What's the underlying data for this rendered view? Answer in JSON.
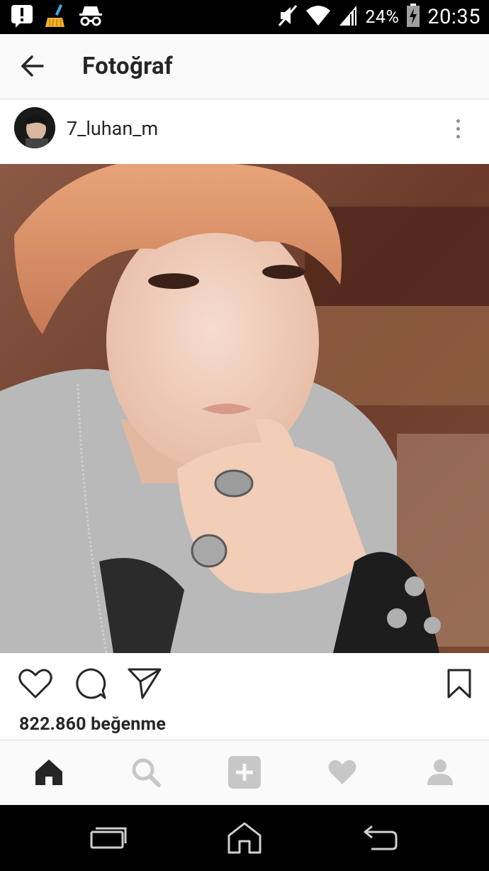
{
  "status_bar": {
    "battery_percent_text": "24%",
    "time": "20:35",
    "icons": [
      "alert-icon",
      "cleaner-broom-icon",
      "incognito-icon",
      "mute-icon",
      "wifi-icon",
      "signal-icon",
      "battery-charging-icon"
    ],
    "battery_level": 0.24
  },
  "header": {
    "title": "Fotoğraf",
    "back_icon": "arrow-left-icon"
  },
  "post": {
    "username": "7_luhan_m",
    "likes_text": "822.860 beğenme",
    "actions": [
      "heart-icon",
      "comment-icon",
      "share-icon",
      "bookmark-icon"
    ],
    "more_icon": "more-vertical-icon"
  },
  "tab_bar": {
    "tabs": [
      "home-icon",
      "search-icon",
      "add-icon",
      "activity-heart-icon",
      "profile-icon"
    ],
    "active_tab": "home-icon"
  },
  "nav_bar": {
    "buttons": [
      "recents-icon",
      "home-nav-icon",
      "back-nav-icon"
    ]
  },
  "colors": {
    "text_primary": "#262626",
    "icon_inactive": "#c7c7c7",
    "divider": "#dbdbdb",
    "bar_background": "#fafafa"
  }
}
